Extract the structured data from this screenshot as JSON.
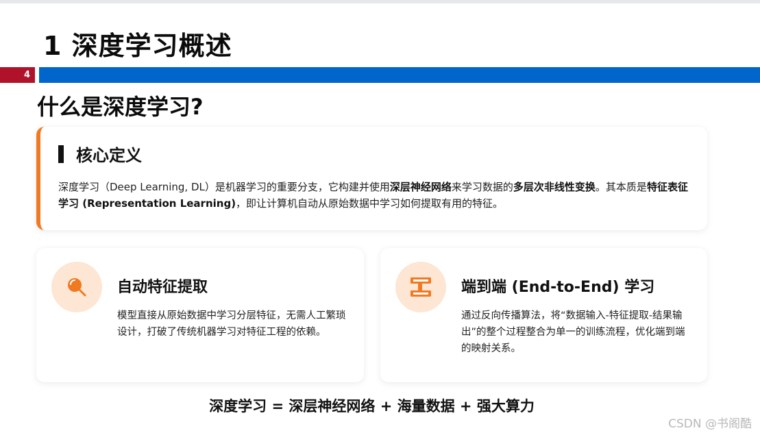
{
  "slide": {
    "title": "1 深度学习概述",
    "page_number": "4",
    "section_title": "什么是深度学习?"
  },
  "definition": {
    "heading": "核心定义",
    "text_parts": [
      {
        "text": "深度学习（Deep Learning, DL）是机器学习的重要分支，它构建并使用",
        "bold": false
      },
      {
        "text": "深层神经网络",
        "bold": true
      },
      {
        "text": "来学习数据的",
        "bold": false
      },
      {
        "text": "多层次非线性变换",
        "bold": true
      },
      {
        "text": "。其本质是",
        "bold": false
      },
      {
        "text": "特征表征学习 (Representation Learning)",
        "bold": true
      },
      {
        "text": "，即让计算机自动从原始数据中学习如何提取有用的特征。",
        "bold": false
      }
    ]
  },
  "features": [
    {
      "icon": "magnifier-icon",
      "title": "自动特征提取",
      "text": "模型直接从原始数据中学习分层特征，无需人工繁琐设计，打破了传统机器学习对特征工程的依赖。"
    },
    {
      "icon": "pipeline-icon",
      "title": "端到端 (End-to-End) 学习",
      "text": "通过反向传播算法，将“数据输入-特征提取-结果输出”的整个过程整合为单一的训练流程，优化端到端的映射关系。"
    }
  ],
  "formula": "深度学习 = 深层神经网络 + 海量数据 + 强大算力",
  "watermark": "CSDN @书阁酷",
  "colors": {
    "accent_orange": "#f07a22",
    "icon_bg": "#fde6d3",
    "header_blue": "#0066cc",
    "page_red": "#b0122a"
  }
}
